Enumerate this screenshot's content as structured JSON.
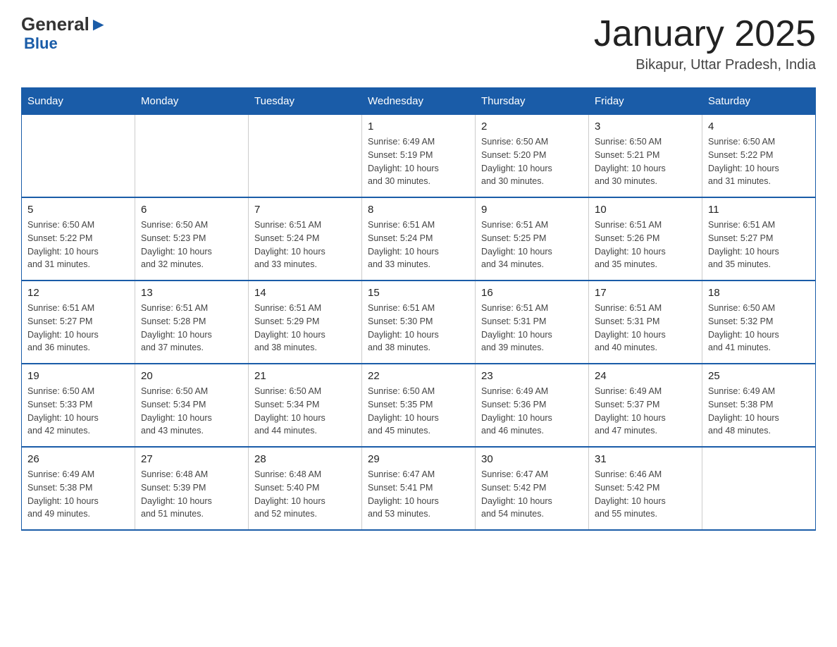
{
  "header": {
    "logo_general": "General",
    "logo_blue": "Blue",
    "month_title": "January 2025",
    "location": "Bikapur, Uttar Pradesh, India"
  },
  "days_of_week": [
    "Sunday",
    "Monday",
    "Tuesday",
    "Wednesday",
    "Thursday",
    "Friday",
    "Saturday"
  ],
  "weeks": [
    [
      {
        "day": "",
        "info": ""
      },
      {
        "day": "",
        "info": ""
      },
      {
        "day": "",
        "info": ""
      },
      {
        "day": "1",
        "info": "Sunrise: 6:49 AM\nSunset: 5:19 PM\nDaylight: 10 hours\nand 30 minutes."
      },
      {
        "day": "2",
        "info": "Sunrise: 6:50 AM\nSunset: 5:20 PM\nDaylight: 10 hours\nand 30 minutes."
      },
      {
        "day": "3",
        "info": "Sunrise: 6:50 AM\nSunset: 5:21 PM\nDaylight: 10 hours\nand 30 minutes."
      },
      {
        "day": "4",
        "info": "Sunrise: 6:50 AM\nSunset: 5:22 PM\nDaylight: 10 hours\nand 31 minutes."
      }
    ],
    [
      {
        "day": "5",
        "info": "Sunrise: 6:50 AM\nSunset: 5:22 PM\nDaylight: 10 hours\nand 31 minutes."
      },
      {
        "day": "6",
        "info": "Sunrise: 6:50 AM\nSunset: 5:23 PM\nDaylight: 10 hours\nand 32 minutes."
      },
      {
        "day": "7",
        "info": "Sunrise: 6:51 AM\nSunset: 5:24 PM\nDaylight: 10 hours\nand 33 minutes."
      },
      {
        "day": "8",
        "info": "Sunrise: 6:51 AM\nSunset: 5:24 PM\nDaylight: 10 hours\nand 33 minutes."
      },
      {
        "day": "9",
        "info": "Sunrise: 6:51 AM\nSunset: 5:25 PM\nDaylight: 10 hours\nand 34 minutes."
      },
      {
        "day": "10",
        "info": "Sunrise: 6:51 AM\nSunset: 5:26 PM\nDaylight: 10 hours\nand 35 minutes."
      },
      {
        "day": "11",
        "info": "Sunrise: 6:51 AM\nSunset: 5:27 PM\nDaylight: 10 hours\nand 35 minutes."
      }
    ],
    [
      {
        "day": "12",
        "info": "Sunrise: 6:51 AM\nSunset: 5:27 PM\nDaylight: 10 hours\nand 36 minutes."
      },
      {
        "day": "13",
        "info": "Sunrise: 6:51 AM\nSunset: 5:28 PM\nDaylight: 10 hours\nand 37 minutes."
      },
      {
        "day": "14",
        "info": "Sunrise: 6:51 AM\nSunset: 5:29 PM\nDaylight: 10 hours\nand 38 minutes."
      },
      {
        "day": "15",
        "info": "Sunrise: 6:51 AM\nSunset: 5:30 PM\nDaylight: 10 hours\nand 38 minutes."
      },
      {
        "day": "16",
        "info": "Sunrise: 6:51 AM\nSunset: 5:31 PM\nDaylight: 10 hours\nand 39 minutes."
      },
      {
        "day": "17",
        "info": "Sunrise: 6:51 AM\nSunset: 5:31 PM\nDaylight: 10 hours\nand 40 minutes."
      },
      {
        "day": "18",
        "info": "Sunrise: 6:50 AM\nSunset: 5:32 PM\nDaylight: 10 hours\nand 41 minutes."
      }
    ],
    [
      {
        "day": "19",
        "info": "Sunrise: 6:50 AM\nSunset: 5:33 PM\nDaylight: 10 hours\nand 42 minutes."
      },
      {
        "day": "20",
        "info": "Sunrise: 6:50 AM\nSunset: 5:34 PM\nDaylight: 10 hours\nand 43 minutes."
      },
      {
        "day": "21",
        "info": "Sunrise: 6:50 AM\nSunset: 5:34 PM\nDaylight: 10 hours\nand 44 minutes."
      },
      {
        "day": "22",
        "info": "Sunrise: 6:50 AM\nSunset: 5:35 PM\nDaylight: 10 hours\nand 45 minutes."
      },
      {
        "day": "23",
        "info": "Sunrise: 6:49 AM\nSunset: 5:36 PM\nDaylight: 10 hours\nand 46 minutes."
      },
      {
        "day": "24",
        "info": "Sunrise: 6:49 AM\nSunset: 5:37 PM\nDaylight: 10 hours\nand 47 minutes."
      },
      {
        "day": "25",
        "info": "Sunrise: 6:49 AM\nSunset: 5:38 PM\nDaylight: 10 hours\nand 48 minutes."
      }
    ],
    [
      {
        "day": "26",
        "info": "Sunrise: 6:49 AM\nSunset: 5:38 PM\nDaylight: 10 hours\nand 49 minutes."
      },
      {
        "day": "27",
        "info": "Sunrise: 6:48 AM\nSunset: 5:39 PM\nDaylight: 10 hours\nand 51 minutes."
      },
      {
        "day": "28",
        "info": "Sunrise: 6:48 AM\nSunset: 5:40 PM\nDaylight: 10 hours\nand 52 minutes."
      },
      {
        "day": "29",
        "info": "Sunrise: 6:47 AM\nSunset: 5:41 PM\nDaylight: 10 hours\nand 53 minutes."
      },
      {
        "day": "30",
        "info": "Sunrise: 6:47 AM\nSunset: 5:42 PM\nDaylight: 10 hours\nand 54 minutes."
      },
      {
        "day": "31",
        "info": "Sunrise: 6:46 AM\nSunset: 5:42 PM\nDaylight: 10 hours\nand 55 minutes."
      },
      {
        "day": "",
        "info": ""
      }
    ]
  ]
}
